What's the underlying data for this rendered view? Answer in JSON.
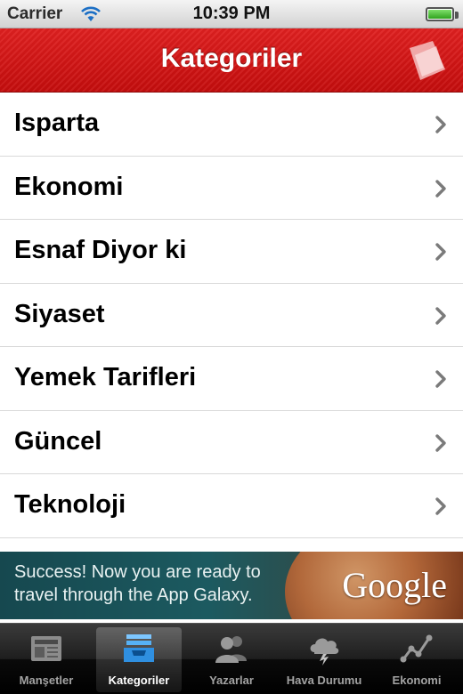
{
  "status_bar": {
    "carrier": "Carrier",
    "time": "10:39 PM",
    "battery_level": 1.0
  },
  "nav": {
    "title": "Kategoriler",
    "accent": "#d41515",
    "logo_icon": "app-logo-icon"
  },
  "categories": [
    {
      "label": "Isparta"
    },
    {
      "label": "Ekonomi"
    },
    {
      "label": "Esnaf Diyor ki"
    },
    {
      "label": "Siyaset"
    },
    {
      "label": "Yemek Tarifleri"
    },
    {
      "label": "Güncel"
    },
    {
      "label": "Teknoloji"
    }
  ],
  "ad": {
    "line1": "Success! Now you are ready to",
    "line2": "travel through the App Galaxy.",
    "brand": "Google"
  },
  "tabs": [
    {
      "label": "Manşetler",
      "icon": "newspaper-icon",
      "selected": false
    },
    {
      "label": "Kategoriler",
      "icon": "inbox-tray-icon",
      "selected": true
    },
    {
      "label": "Yazarlar",
      "icon": "people-icon",
      "selected": false
    },
    {
      "label": "Hava Durumu",
      "icon": "weather-cloud-icon",
      "selected": false
    },
    {
      "label": "Ekonomi",
      "icon": "line-chart-icon",
      "selected": false
    }
  ],
  "colors": {
    "tab_selected": "#3aa0ec",
    "tab_unselected": "#9a9a9a",
    "nav_red": "#d41515"
  }
}
